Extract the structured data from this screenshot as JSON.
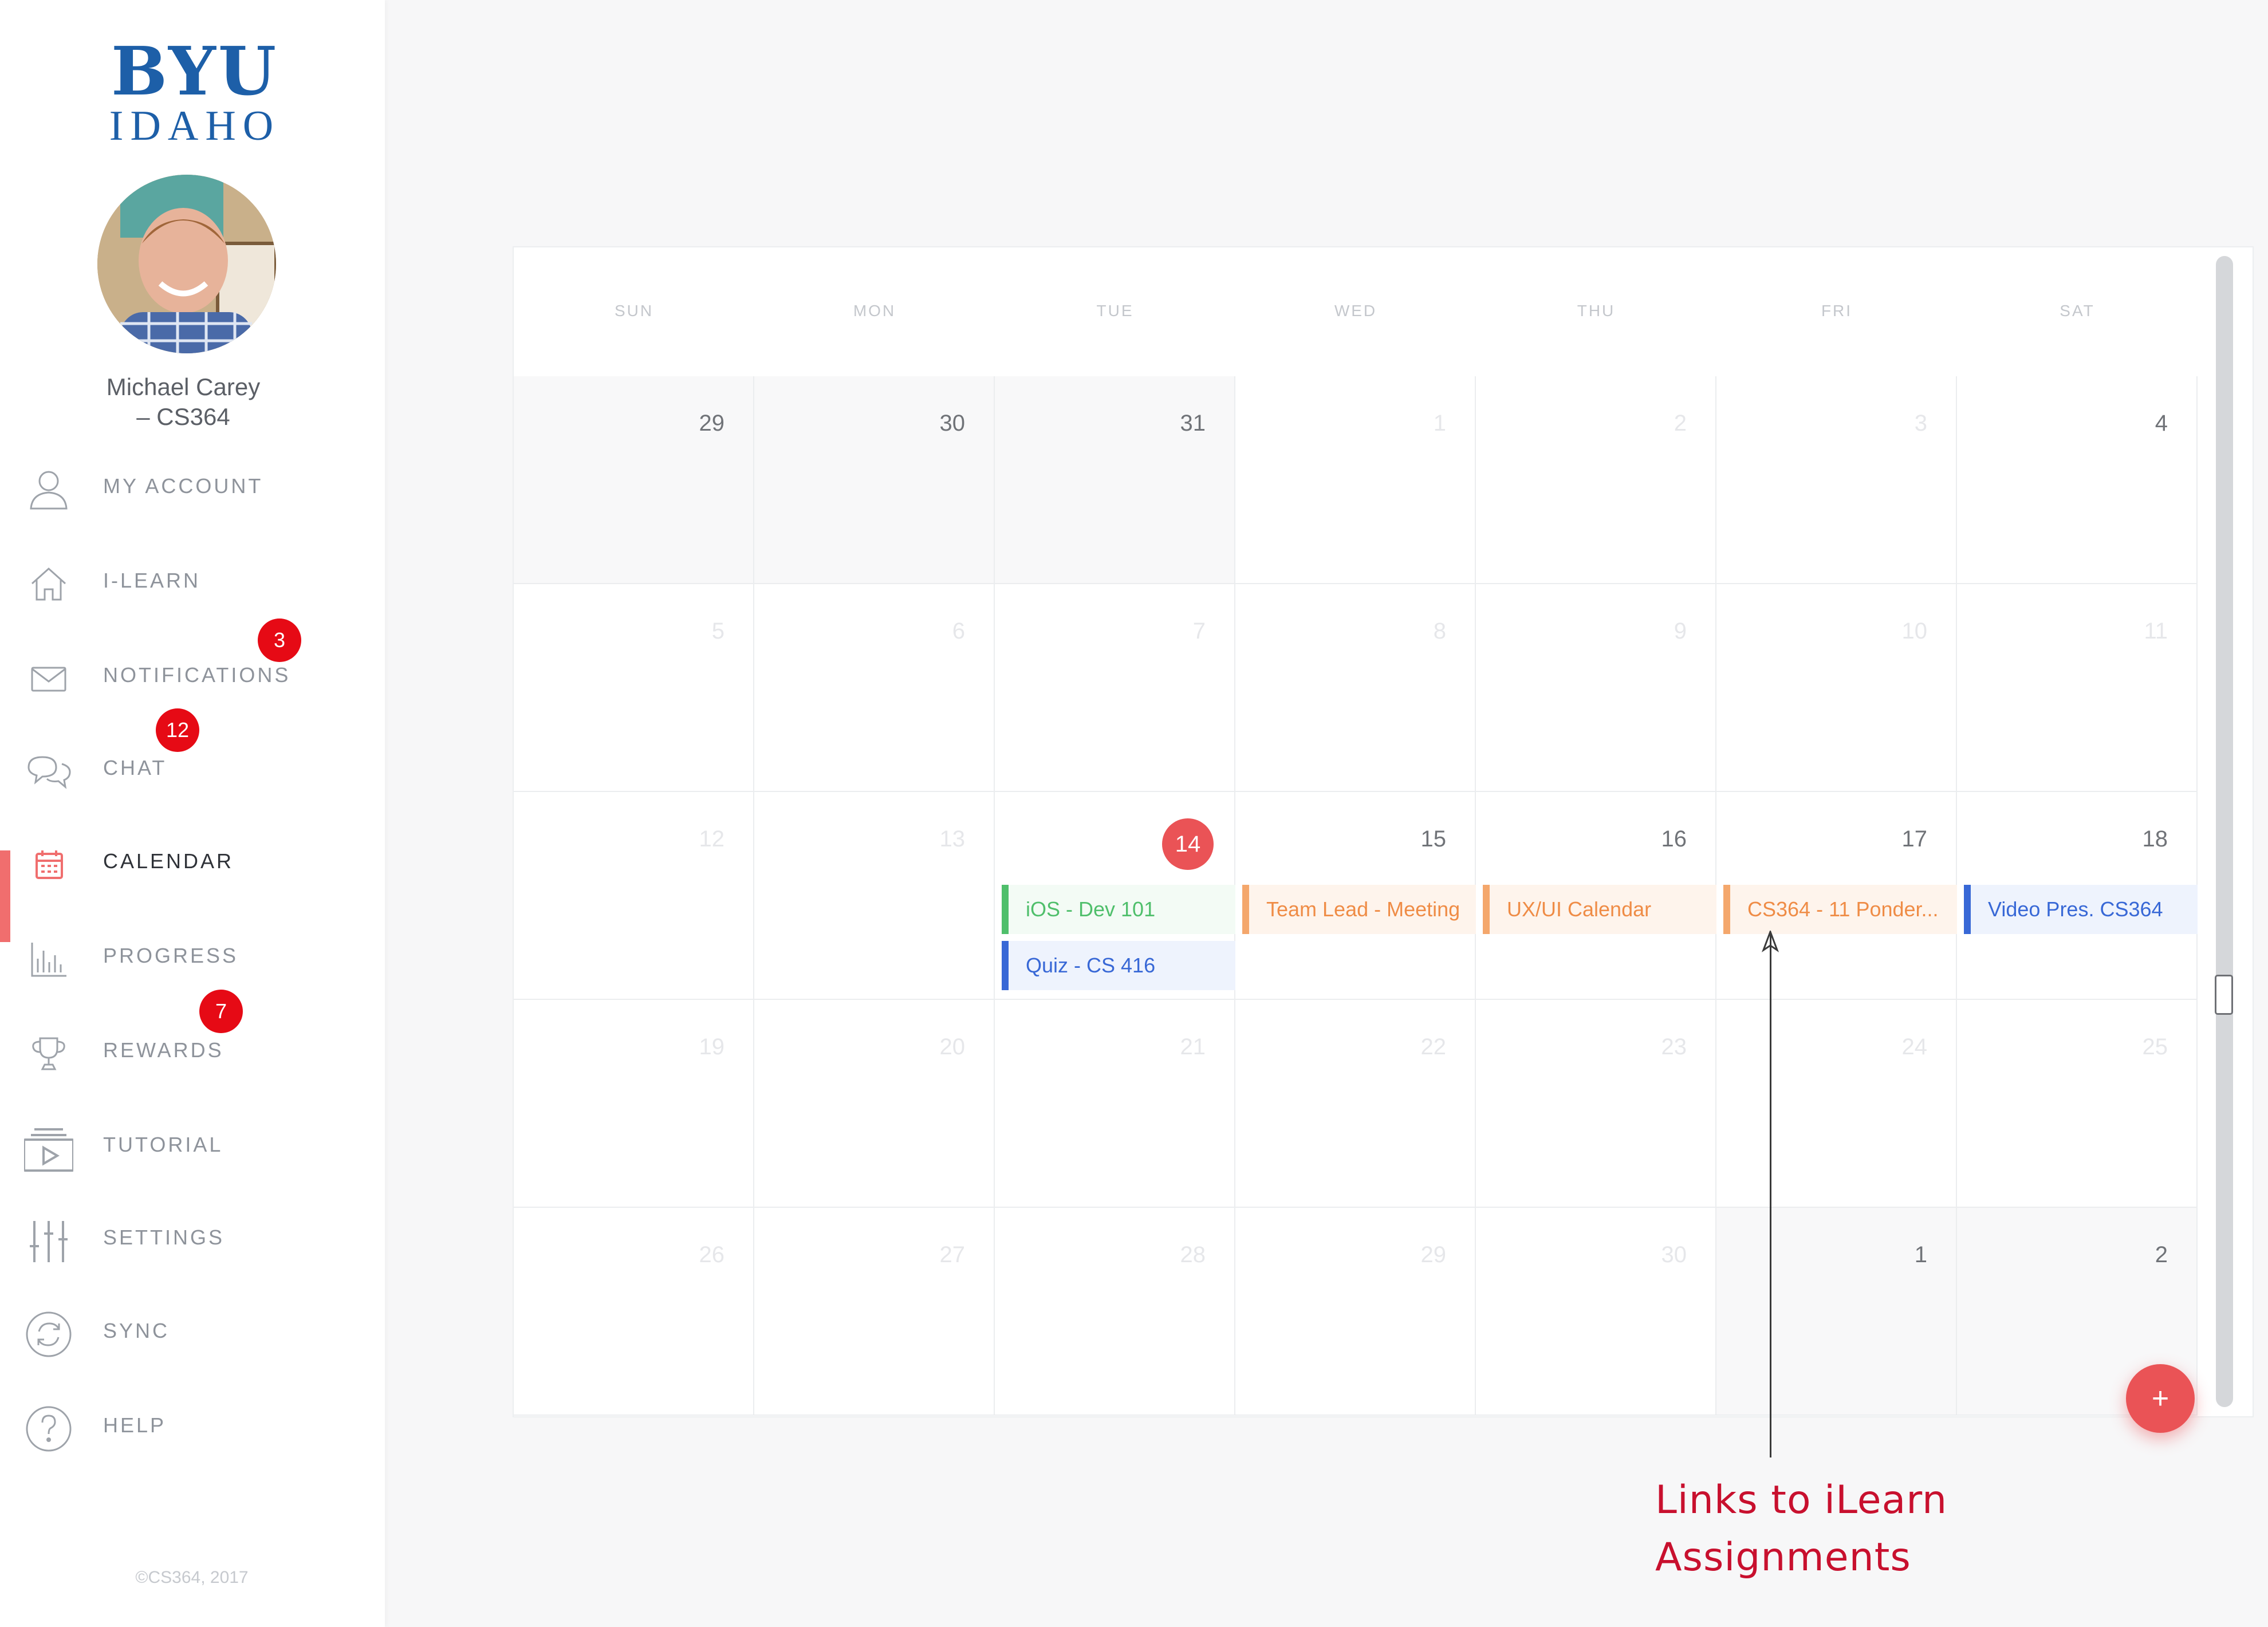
{
  "sidebar": {
    "logo": {
      "line1": "BYU",
      "line2": "IDAHO"
    },
    "user": {
      "name_line1": "Michael Carey",
      "name_line2": "– CS364"
    },
    "items": [
      {
        "label": "MY ACCOUNT",
        "icon": "user-icon"
      },
      {
        "label": "I-LEARN",
        "icon": "home-icon"
      },
      {
        "label": "NOTIFICATIONS",
        "icon": "mail-icon",
        "badge": "3"
      },
      {
        "label": "CHAT",
        "icon": "chat-icon",
        "badge": "12"
      },
      {
        "label": "CALENDAR",
        "icon": "calendar-icon",
        "active": true
      },
      {
        "label": "PROGRESS",
        "icon": "bar-chart-icon"
      },
      {
        "label": "REWARDS",
        "icon": "trophy-icon",
        "badge": "7"
      },
      {
        "label": "TUTORIAL",
        "icon": "video-icon"
      },
      {
        "label": "SETTINGS",
        "icon": "sliders-icon"
      },
      {
        "label": "SYNC",
        "icon": "sync-icon"
      },
      {
        "label": "HELP",
        "icon": "help-icon"
      }
    ],
    "copyright": "©CS364, 2017"
  },
  "calendar": {
    "weekdays": [
      "SUN",
      "MON",
      "TUE",
      "WED",
      "THU",
      "FRI",
      "SAT"
    ],
    "weeks": [
      [
        "29",
        "30",
        "31",
        "1",
        "2",
        "3",
        "4"
      ],
      [
        "5",
        "6",
        "7",
        "8",
        "9",
        "10",
        "11"
      ],
      [
        "12",
        "13",
        "14",
        "15",
        "16",
        "17",
        "18"
      ],
      [
        "19",
        "20",
        "21",
        "22",
        "23",
        "24",
        "25"
      ],
      [
        "26",
        "27",
        "28",
        "29",
        "30",
        "1",
        "2"
      ]
    ],
    "today": "14",
    "events": {
      "tue": [
        "iOS - Dev 101",
        "Quiz - CS 416"
      ],
      "wed": "Team Lead - Meeting",
      "thu": "UX/UI Calendar",
      "fri": "CS364 - 11 Ponder...",
      "sat": "Video Pres. CS364"
    },
    "add_button": "+",
    "colors": {
      "today": "#ea5356",
      "green": "#4fbf6b",
      "blue": "#3868d6",
      "orange": "#ef8c46"
    }
  },
  "annotation": {
    "line1": "Links to iLearn",
    "line2": "Assignments"
  }
}
